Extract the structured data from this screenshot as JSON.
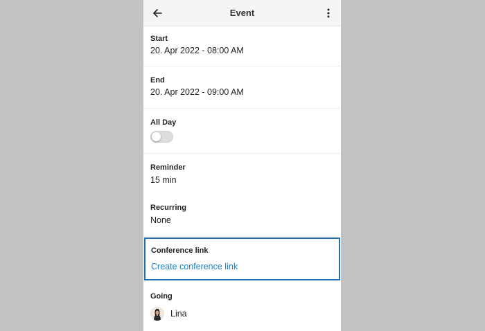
{
  "appbar": {
    "title": "Event",
    "back_icon": "arrow-left-icon",
    "more_icon": "more-vertical-icon"
  },
  "fields": {
    "start": {
      "label": "Start",
      "value": "20. Apr 2022 - 08:00 AM"
    },
    "end": {
      "label": "End",
      "value": "20. Apr 2022 - 09:00 AM"
    },
    "all_day": {
      "label": "All Day",
      "enabled": false
    },
    "reminder": {
      "label": "Reminder",
      "value": "15 min"
    },
    "recurring": {
      "label": "Recurring",
      "value": "None"
    },
    "conference": {
      "label": "Conference link",
      "link_text": "Create conference link"
    },
    "going": {
      "label": "Going",
      "attendees": [
        {
          "name": "Lina"
        }
      ]
    }
  },
  "colors": {
    "accent": "#1a7fc1",
    "focus_border": "#1d6fb8",
    "backdrop": "#c2c2c2"
  }
}
